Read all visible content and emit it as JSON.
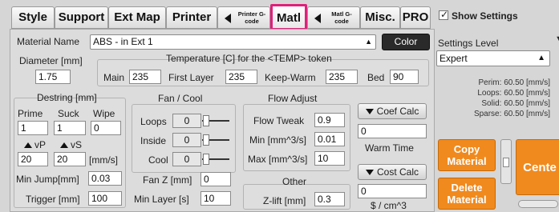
{
  "tabs": {
    "style": "Style",
    "support": "Support",
    "ext_map": "Ext Map",
    "printer": "Printer",
    "printer_gcode": "Printer G-code",
    "matl": "Matl",
    "matl_gcode": "Matl G-code",
    "misc": "Misc.",
    "pro": "PRO"
  },
  "material": {
    "name_label": "Material Name",
    "name_value": "ABS - in Ext 1",
    "color_button": "Color",
    "diameter_label": "Diameter [mm]",
    "diameter_value": "1.75"
  },
  "temperature": {
    "title": "Temperature [C] for the <TEMP> token",
    "main_label": "Main",
    "main_value": "235",
    "first_layer_label": "First Layer",
    "first_layer_value": "235",
    "keep_warm_label": "Keep-Warm",
    "keep_warm_value": "235",
    "bed_label": "Bed",
    "bed_value": "90"
  },
  "destring": {
    "title": "Destring [mm]",
    "prime_label": "Prime",
    "prime_value": "1",
    "suck_label": "Suck",
    "suck_value": "1",
    "wipe_label": "Wipe",
    "wipe_value": "0",
    "vp_label": "vP",
    "vs_label": "vS",
    "vp_value": "20",
    "vs_value": "20",
    "speed_unit": "[mm/s]",
    "min_jump_label": "Min Jump[mm]",
    "min_jump_value": "0.03",
    "trigger_label": "Trigger [mm]",
    "trigger_value": "100"
  },
  "fan": {
    "title": "Fan / Cool",
    "loops_label": "Loops",
    "loops_value": "0",
    "inside_label": "Inside",
    "inside_value": "0",
    "cool_label": "Cool",
    "cool_value": "0",
    "fan_z_label": "Fan Z [mm]",
    "fan_z_value": "0",
    "min_layer_label": "Min Layer [s]",
    "min_layer_value": "10"
  },
  "flow": {
    "title": "Flow Adjust",
    "tweak_label": "Flow Tweak",
    "tweak_value": "0.9",
    "min_label": "Min [mm^3/s]",
    "min_value": "0.01",
    "max_label": "Max [mm^3/s]",
    "max_value": "10",
    "coef_calc_button": "Coef Calc",
    "coef_value": "0",
    "warm_time_label": "Warm Time",
    "cost_calc_button": "Cost Calc",
    "cost_value": "0",
    "cost_unit": "$ / cm^3"
  },
  "other": {
    "title": "Other",
    "zlift_label": "Z-lift [mm]",
    "zlift_value": "0.3"
  },
  "right": {
    "show_settings": "Show Settings",
    "show_settings_checked": true,
    "settings_level_label": "Settings Level",
    "settings_level_value": "Expert",
    "stats": [
      {
        "label": "Perim:",
        "value": "60.50 [mm/s]"
      },
      {
        "label": "Loops:",
        "value": "60.50 [mm/s]"
      },
      {
        "label": "Solid:",
        "value": "60.50 [mm/s]"
      },
      {
        "label": "Sparse:",
        "value": "60.50 [mm/s]"
      }
    ],
    "copy_material": "Copy Material",
    "delete_material": "Delete Material",
    "center": "Cente"
  },
  "colors": {
    "highlight": "#e0207a",
    "orange": "#f08a1e",
    "background": "#d6d6d6"
  }
}
